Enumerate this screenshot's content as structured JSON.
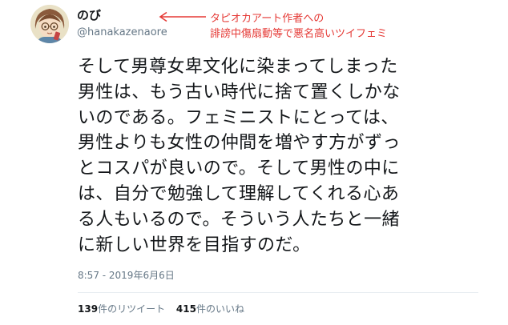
{
  "profile": {
    "display_name": "のび",
    "handle": "@hanakazenaore",
    "avatar_icon": "user-avatar-icon"
  },
  "annotation": {
    "color": "#e53935",
    "line1": "タピオカアート作者への",
    "line2": "誹謗中傷扇動等で悪名高いツイフェミ"
  },
  "tweet": {
    "lines": [
      "そして男尊女卑文化に染まってしまった",
      "男性は、もう古い時代に捨て置くしかな",
      "いのである。フェミニストにとっては、",
      "男性よりも女性の仲間を増やす方がずっ",
      "とコスパが良いので。そして男性の中に",
      "は、自分で勉強して理解してくれる心あ",
      "る人もいるので。そういう人たちと一緒",
      "に新しい世界を目指すのだ。"
    ],
    "timestamp": "8:57 - 2019年6月6日"
  },
  "stats": {
    "retweets_count": "139",
    "retweets_label": "件のリツイート",
    "likes_count": "415",
    "likes_label": "件のいいね"
  }
}
